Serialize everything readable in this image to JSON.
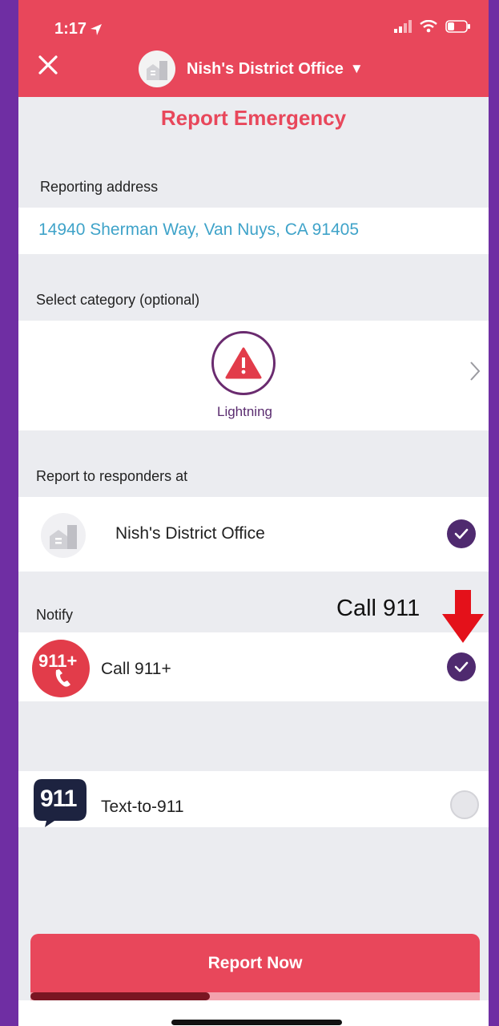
{
  "status_bar": {
    "time": "1:17"
  },
  "header": {
    "office_name": "Nish's District Office",
    "dropdown_glyph": "▼"
  },
  "page_title": "Report Emergency",
  "address": {
    "label": "Reporting address",
    "value": "14940 Sherman Way, Van Nuys, CA  91405"
  },
  "category": {
    "label": "Select category (optional)",
    "selected": "Lightning",
    "icon": "warning-triangle-icon"
  },
  "responders": {
    "label": "Report to responders at",
    "office": "Nish's District Office",
    "checked": true
  },
  "notify": {
    "label": "Notify",
    "annotation": "Call 911",
    "options": [
      {
        "label": "Call 911+",
        "logo_text": "911+",
        "checked": true
      },
      {
        "label": "Text-to-911",
        "logo_text": "911",
        "checked": false
      }
    ]
  },
  "report_button": {
    "label": "Report Now"
  },
  "progress": {
    "fraction": 0.4
  },
  "colors": {
    "brand_red": "#e8475b",
    "accent_purple": "#4f2a6f",
    "link_blue": "#3fa3c9",
    "frame_purple": "#6f2ea3"
  }
}
